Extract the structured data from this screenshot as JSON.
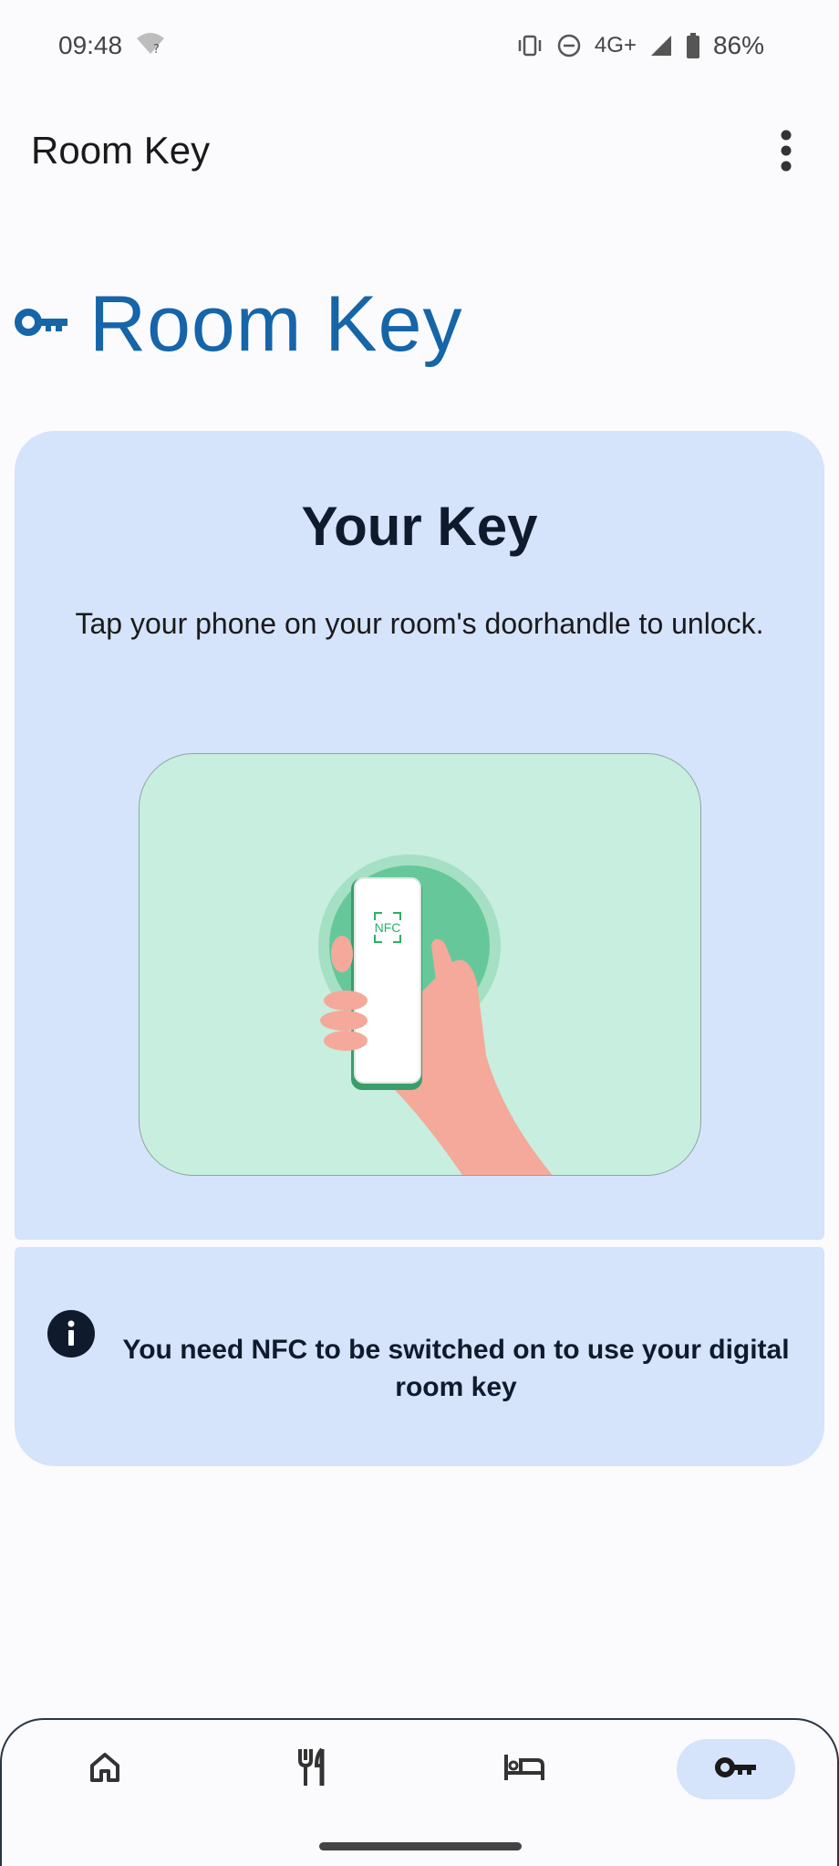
{
  "status_bar": {
    "time": "09:48",
    "network": "4G+",
    "battery": "86%",
    "icons": [
      "wifi-unknown-icon",
      "vibrate-icon",
      "do-not-disturb-icon",
      "signal-icon",
      "battery-icon"
    ]
  },
  "app_bar": {
    "title": "Room Key",
    "menu_icon": "more-vert-icon"
  },
  "page": {
    "heading": "Room Key",
    "heading_icon": "key-icon"
  },
  "key_card": {
    "title": "Your Key",
    "description": "Tap your phone on your room's doorhandle to unlock.",
    "illustration_label": "NFC"
  },
  "info_card": {
    "icon": "info-icon",
    "message": "You need NFC to be switched on to use your digital room key"
  },
  "bottom_nav": {
    "items": [
      {
        "icon": "home-icon",
        "active": false
      },
      {
        "icon": "restaurant-icon",
        "active": false
      },
      {
        "icon": "bed-icon",
        "active": false
      },
      {
        "icon": "key-icon",
        "active": true
      }
    ]
  },
  "colors": {
    "accent": "#1565a8",
    "card_bg": "#d5e3fb",
    "illustration_bg": "#c7eedf",
    "nfc_green": "#2bb06a"
  }
}
